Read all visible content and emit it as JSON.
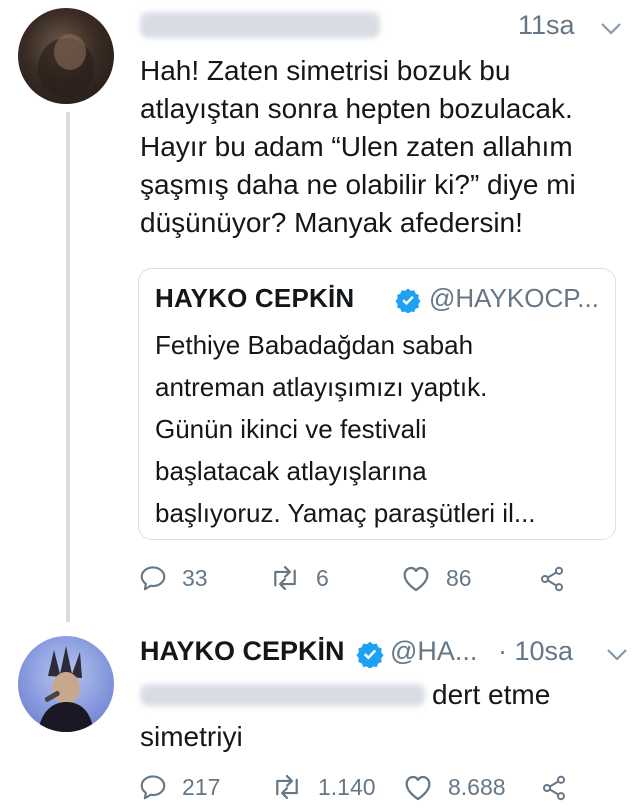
{
  "tweet1": {
    "time": "11sa",
    "text_lines": [
      "Hah! Zaten simetrisi bozuk bu",
      "atlayıştan sonra hepten bozulacak.",
      "Hayır bu adam “Ulen zaten allahım",
      "şaşmış daha ne olabilir ki?” diye mi",
      "düşünüyor? Manyak afedersin!"
    ],
    "quote": {
      "name": "HAYKO CEPKİN",
      "handle": "@HAYKOCP...",
      "text_lines": [
        "Fethiye Babadağdan sabah",
        "antreman atlayışımızı yaptık.",
        "Günün ikinci ve festivali",
        "başlatacak atlayışlarına",
        "başlıyoruz. Yamaç paraşütleri il..."
      ]
    },
    "replies": "33",
    "retweets": "6",
    "likes": "86"
  },
  "tweet2": {
    "name": "HAYKO CEPKİN",
    "handle": "@HA...",
    "time": "· 10sa",
    "text_line1": "dert etme",
    "text_line2": "simetriyi",
    "replies": "217",
    "retweets": "1.140",
    "likes": "8.688"
  },
  "colors": {
    "verified": "#1da1f2",
    "muted": "#657786",
    "text": "#14171a"
  }
}
